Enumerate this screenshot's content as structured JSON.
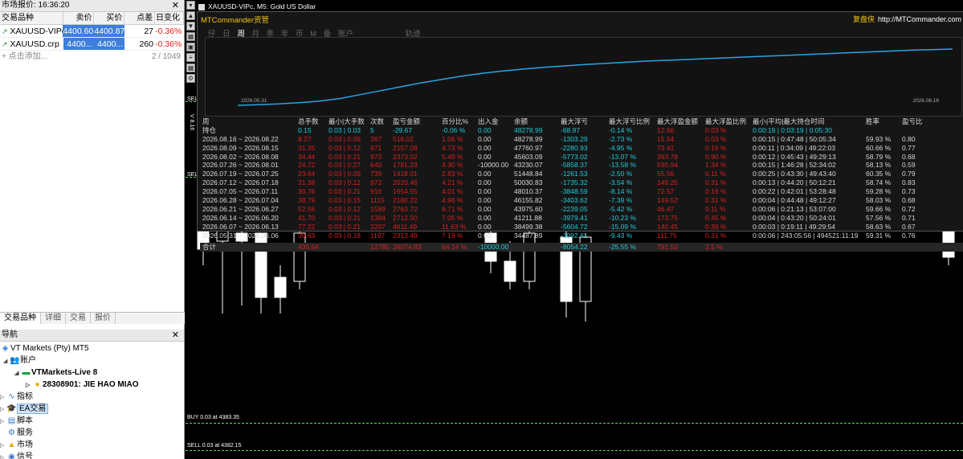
{
  "market_watch": {
    "title": "市场报价: 16:36:20",
    "headers": [
      "交易品种",
      "卖价",
      "买价",
      "点差",
      "日变化"
    ],
    "rows": [
      {
        "symbol": "XAUUSD-VIPc",
        "bid": "4400.60",
        "ask": "4400.87",
        "spread": "27",
        "change": "-0.36%"
      },
      {
        "symbol": "XAUUSD.crp",
        "bid": "4400...",
        "ask": "4400...",
        "spread": "260",
        "change": "-0.36%"
      }
    ],
    "add_label": "点击添加...",
    "count": "2 / 1049",
    "tabs": [
      "交易品种",
      "详细",
      "交易",
      "报价"
    ]
  },
  "navigator": {
    "title": "导航",
    "broker": "VT Markets (Pty) MT5",
    "accounts": "账户",
    "server": "VTMarkets-Live 8",
    "account": "28308901: JIE HAO MIAO",
    "indicators": "指标",
    "ea": "EA交易",
    "scripts": "脚本",
    "services": "服务",
    "market": "市场",
    "signals": "信号"
  },
  "chart": {
    "symbol_title": "XAUUSD-VIPc, M5:  Gold US Dollar",
    "sell_label": "SELL",
    "buy_line": "BUY 0.03 at 4383.35",
    "sell_line": "SELL 0.03 at 4382.15",
    "side_text": "V 8.16"
  },
  "dialog": {
    "title": "MTCommander资管",
    "link_label": "复盘侠",
    "link_url": "http://MTCommander.com",
    "tabs": [
      "仔",
      "日",
      "周",
      "月",
      "季",
      "年",
      "币",
      "M",
      "备",
      "账户",
      "轨迹"
    ],
    "active_tab": "周",
    "curve_start": "2026.05.31",
    "curve_end": "2026.06.16",
    "headers": [
      "周",
      "总手数",
      "最小|大手数",
      "次数",
      "盈亏金额",
      "百分比%",
      "出入金",
      "余额",
      "最大浮亏",
      "最大浮亏比例",
      "最大浮盈金额",
      "最大浮盈比例",
      "最小|平均|最大持仓时间",
      "胜率",
      "盈亏比"
    ],
    "hold_row": [
      "持仓",
      "0.15",
      "0.03 | 0.03",
      "5",
      "-29.67",
      "-0.06 %",
      "0.00",
      "48278.99",
      "-68.97",
      "-0.14 %",
      "12.66",
      "0.03 %",
      "0:00:19 | 0:03:19 | 0:05:30",
      "",
      ""
    ],
    "rows": [
      [
        "2026.08.16 ~ 2026.08.22",
        "8.27",
        "0.03 | 0.09",
        "267",
        "516.02",
        "1.06 %",
        "0.00",
        "48278.99",
        "-1303.29",
        "-2.73 %",
        "15.54",
        "0.03 %",
        "0:00:15 | 0:47:48 | 50:05:34",
        "59.93 %",
        "0.80"
      ],
      [
        "2026.08.09 ~ 2026.08.15",
        "31.35",
        "0.03 | 0.12",
        "971",
        "2157.08",
        "4.73 %",
        "0.00",
        "47760.97",
        "-2280.93",
        "-4.95 %",
        "73.41",
        "0.16 %",
        "0:00:11 | 0:34:09 | 49:22:03",
        "60.66 %",
        "0.77"
      ],
      [
        "2026.08.02 ~ 2026.08.08",
        "34.44",
        "0.03 | 0.21",
        "973",
        "2373.02",
        "5.49 %",
        "0.00",
        "45603.09",
        "-5773.02",
        "-13.07 %",
        "393.78",
        "0.90 %",
        "0:00:12 | 0:45:43 | 49:29:13",
        "58.79 %",
        "0.68"
      ],
      [
        "2026.07.26 ~ 2026.08.01",
        "24.72",
        "0.03 | 0.27",
        "640",
        "1781.23",
        "4.30 %",
        "-10000.00",
        "43230.07",
        "-5858.37",
        "-13.58 %",
        "590.94",
        "1.34 %",
        "0:00:15 | 1:46:28 | 52:34:02",
        "58.13 %",
        "0.59"
      ],
      [
        "2026.07.19 ~ 2026.07.25",
        "23.64",
        "0.03 | 0.09",
        "739",
        "1418.01",
        "2.83 %",
        "0.00",
        "51448.84",
        "-1261.53",
        "-2.50 %",
        "55.56",
        "0.11 %",
        "0:00:25 | 0:43:30 | 49:43:40",
        "60.35 %",
        "0.79"
      ],
      [
        "2026.07.12 ~ 2026.07.18",
        "31.38",
        "0.03 | 0.12",
        "972",
        "2020.46",
        "4.21 %",
        "0.00",
        "50030.83",
        "-1735.32",
        "-3.54 %",
        "149.25",
        "0.31 %",
        "0:00:13 | 0:44:20 | 50:12:21",
        "58.74 %",
        "0.83"
      ],
      [
        "2026.07.05 ~ 2026.07.11",
        "30.76",
        "0.03 | 0.21",
        "916",
        "1654.55",
        "4.01 %",
        "0.00",
        "48010.37",
        "-3848.59",
        "-8.14 %",
        "72.57",
        "0.16 %",
        "0:00:22 | 0:42:01 | 53:28:48",
        "59.28 %",
        "0.73"
      ],
      [
        "2026.06.28 ~ 2026.07.04",
        "38.79",
        "0.03 | 0.15",
        "1115",
        "2180.22",
        "4.96 %",
        "0.00",
        "46155.82",
        "-3403.62",
        "-7.39 %",
        "149.52",
        "0.31 %",
        "0:00:04 | 0:44:48 | 49:12:27",
        "58.03 %",
        "0.68"
      ],
      [
        "2026.06.21 ~ 2026.06.27",
        "52.56",
        "0.03 | 0.12",
        "1589",
        "2763.72",
        "6.71 %",
        "0.00",
        "43975.60",
        "-2239.05",
        "-5.42 %",
        "46.47",
        "0.11 %",
        "0:00:06 | 0:21:13 | 53:07:00",
        "59.66 %",
        "0.72"
      ],
      [
        "2026.06.14 ~ 2026.06.20",
        "41.70",
        "0.03 | 0.21",
        "1384",
        "2712.50",
        "7.05 %",
        "0.00",
        "41211.88",
        "-3979.41",
        "-10.23 %",
        "173.75",
        "0.45 %",
        "0:00:04 | 0:43:20 | 50:24:01",
        "57.56 %",
        "0.71"
      ],
      [
        "2026.06.07 ~ 2026.06.13",
        "77.22",
        "0.03 | 0.21",
        "2207",
        "4611.49",
        "11.63 %",
        "0.00",
        "38499.38",
        "-5604.72",
        "-15.09 %",
        "140.45",
        "0.39 %",
        "0:00:03 | 0:19:11 | 49:29:54",
        "58.63 %",
        "0.67"
      ],
      [
        "2026.05.31 ~ 2026.06.06",
        "39.63",
        "0.03 | 0.18",
        "1197",
        "2313.49",
        "7.19 %",
        "0.00",
        "34487.89",
        "-3092.61",
        "-9.43 %",
        "111.75",
        "0.31 %",
        "0:00:06 | 243:05:56 | 494521:11:19",
        "59.31 %",
        "0.76"
      ]
    ],
    "sum_row": [
      "合计",
      "435.64",
      "",
      "12785",
      "26074.83",
      "64.14 %",
      "-10000.00",
      "",
      "-8054.22",
      "-25.55 %",
      "791.52",
      "2.5 %",
      "",
      "",
      ""
    ]
  },
  "equity_curve": [
    0.0,
    0.01,
    0.025,
    0.045,
    0.075,
    0.12,
    0.19,
    0.26,
    0.33,
    0.4,
    0.46,
    0.52,
    0.57,
    0.61,
    0.645,
    0.675,
    0.7,
    0.725,
    0.745,
    0.765,
    0.785,
    0.8,
    0.815,
    0.83,
    0.845,
    0.86,
    0.875,
    0.89,
    0.905,
    0.92,
    0.935,
    0.95,
    0.965,
    0.98,
    0.99,
    1.0
  ]
}
